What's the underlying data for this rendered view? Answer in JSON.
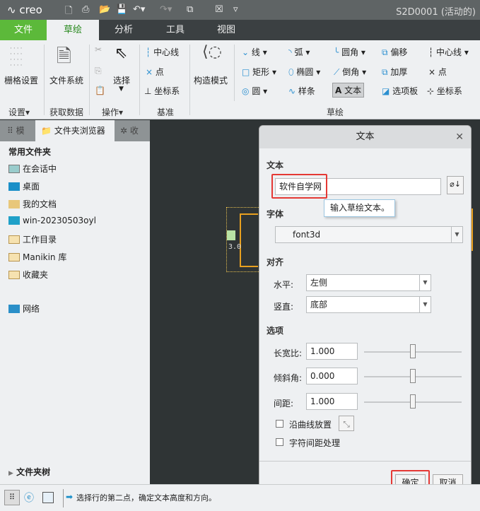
{
  "window": {
    "logo": "creo",
    "title": "S2D0001 (活动的)"
  },
  "tabs": [
    "文件",
    "草绘",
    "分析",
    "工具",
    "视图"
  ],
  "ribbon": {
    "settings": {
      "grid": "栅格设置",
      "group": "设置"
    },
    "getdata": {
      "filesystem": "文件系统",
      "group": "获取数据"
    },
    "ops": {
      "select": "选择",
      "group": "操作"
    },
    "datum": {
      "centerline": "中心线",
      "point": "点",
      "csys": "坐标系",
      "group": "基准"
    },
    "construct": "构造模式",
    "sketch": {
      "line": "线",
      "arc": "弧",
      "fillet": "圆角",
      "offset": "偏移",
      "centerline": "中心线",
      "rect": "矩形",
      "ellipse": "椭圆",
      "chamfer": "倒角",
      "thicken": "加厚",
      "point": "点",
      "circle": "圆",
      "spline": "样条",
      "text": "文本",
      "palette": "选项板",
      "csys": "坐标系",
      "group": "草绘"
    }
  },
  "panel": {
    "tabs": [
      "模",
      "文件夹浏览器",
      "收"
    ],
    "heading": "常用文件夹",
    "items": [
      "在会话中",
      "桌面",
      "我的文档",
      "win-20230503oyl",
      "工作目录",
      "Manikin 库",
      "收藏夹",
      "网络"
    ],
    "tree": "文件夹树"
  },
  "canvas": {
    "dim": "3.0"
  },
  "dialog": {
    "title": "文本",
    "text_label": "文本",
    "text_value": "软件自学网",
    "tooltip": "输入草绘文本。",
    "font_label": "字体",
    "font_value": "font3d",
    "align_label": "对齐",
    "h_label": "水平:",
    "h_value": "左侧",
    "v_label": "竖直:",
    "v_value": "底部",
    "options_label": "选项",
    "aspect_label": "长宽比:",
    "aspect_value": "1.000",
    "slant_label": "倾斜角:",
    "slant_value": "0.000",
    "spacing_label": "间距:",
    "spacing_value": "1.000",
    "curve_label": "沿曲线放置",
    "kern_label": "字符间距处理",
    "ok": "确定",
    "cancel": "取消"
  },
  "status": {
    "message": "选择行的第二点，确定文本高度和方向。"
  }
}
